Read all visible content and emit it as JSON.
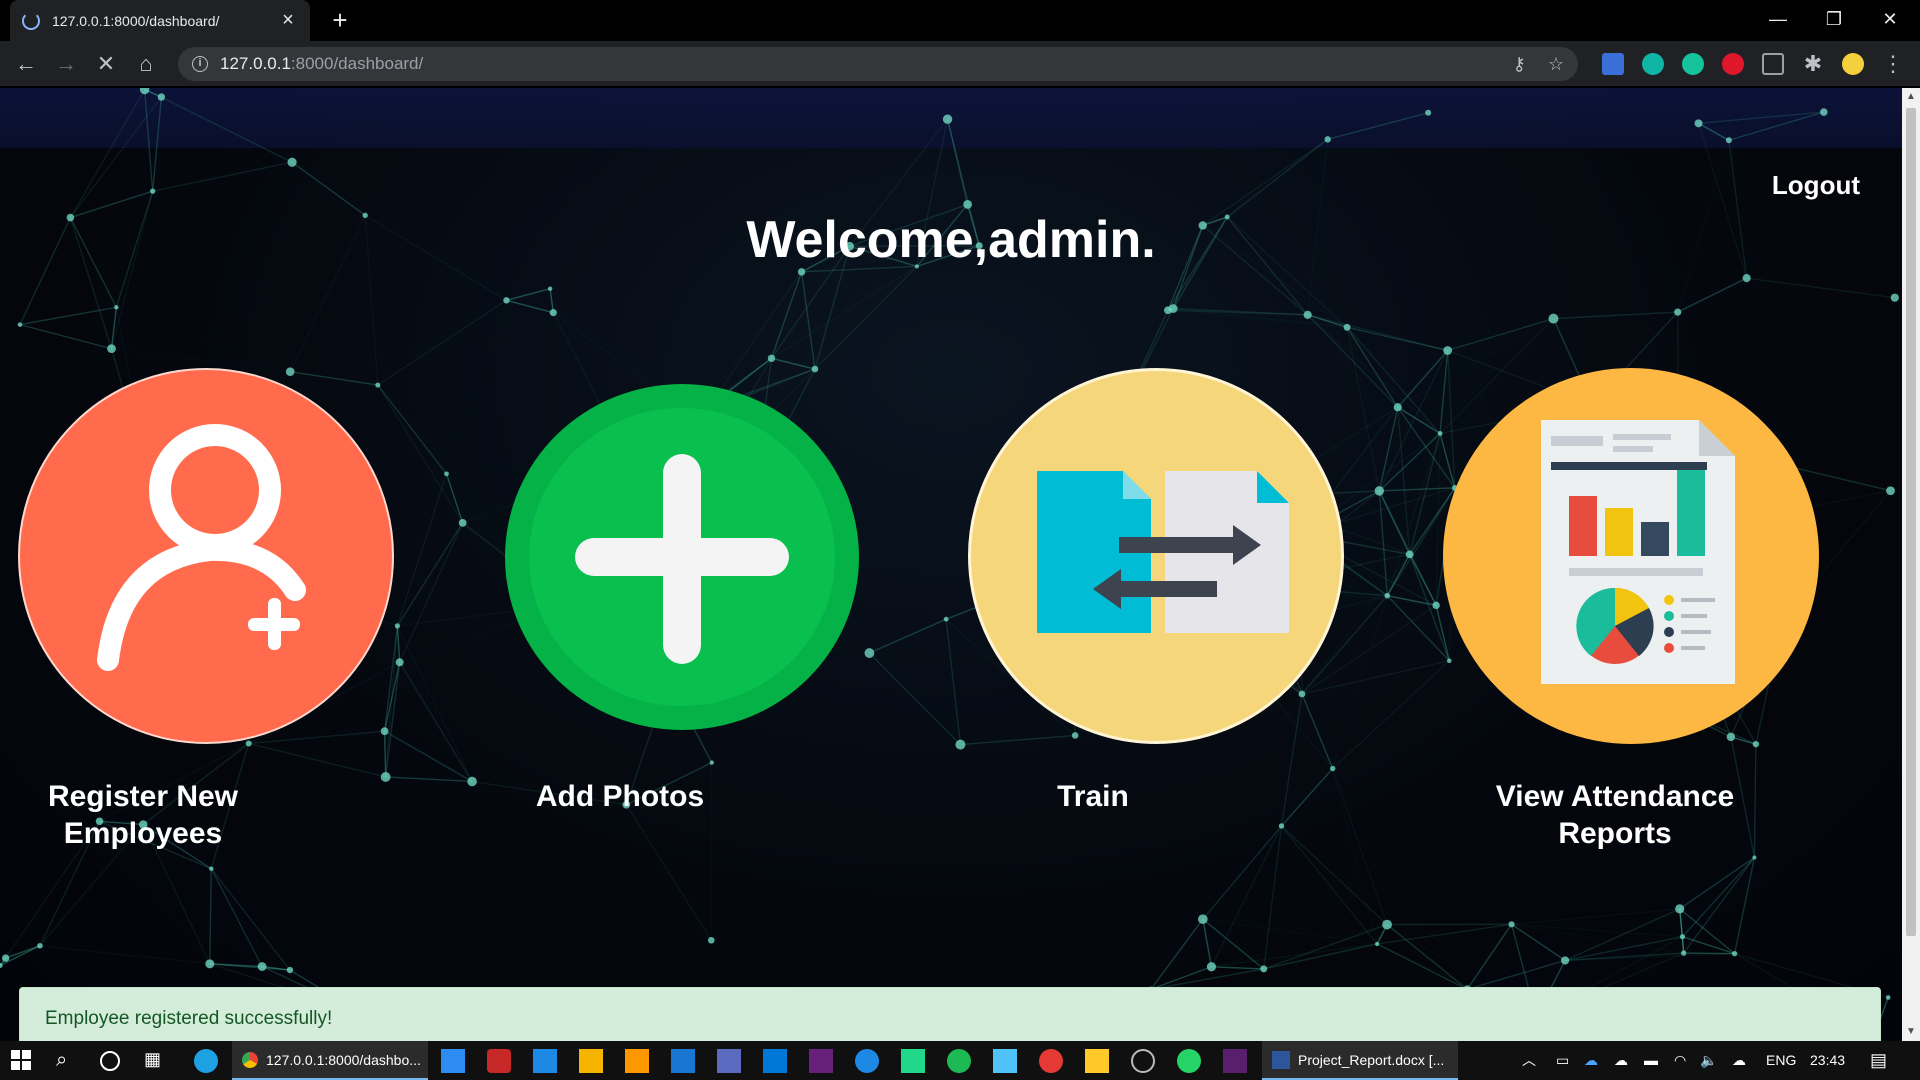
{
  "browser": {
    "tab_title": "127.0.0.1:8000/dashboard/",
    "url_host": "127.0.0.1",
    "url_path": ":8000/dashboard/",
    "icons": [
      "back-icon",
      "forward-icon",
      "stop-icon",
      "home-icon",
      "info-icon",
      "key-icon",
      "star-icon",
      "puzzle-icon",
      "menu-icon"
    ]
  },
  "page": {
    "logout_label": "Logout",
    "welcome_text": "Welcome,admin.",
    "cards": [
      {
        "label_line1": "Register New",
        "label_line2": "Employees",
        "color": "#ff6b4c"
      },
      {
        "label_line1": "Add Photos",
        "label_line2": "",
        "color": "#09c04f"
      },
      {
        "label_line1": "Train",
        "label_line2": "",
        "color": "#f6d67a"
      },
      {
        "label_line1": "View Attendance",
        "label_line2": "Reports",
        "color": "#fdb843"
      }
    ],
    "alert_text": "Employee registered successfully!",
    "alert_color": "#d4edda"
  },
  "taskbar": {
    "chrome_task_label": "127.0.0.1:8000/dashbo...",
    "word_task_label": "Project_Report.docx [...",
    "language": "ENG",
    "time": "23:43"
  }
}
